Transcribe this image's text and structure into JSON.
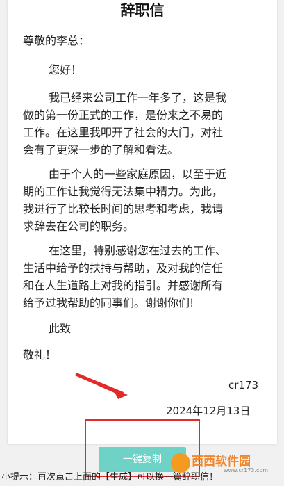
{
  "letter": {
    "title": "辞职信",
    "salutation": "尊敬的李总：",
    "greeting": "您好！",
    "paragraphs": [
      [
        "我已经来公司工作一年多了，这是我",
        "做的第一份正式的工作，是份来之不易的",
        "工作。在这里我叩开了社会的大门，对社",
        "会有了更深一步的了解和看法。"
      ],
      [
        "由于个人的一些家庭原因，以至于近",
        "期的工作让我觉得无法集中精力。为此，",
        "我进行了比较长时间的思考和考虑，我请",
        "求辞去在公司的职务。"
      ],
      [
        "在这里，特别感谢您在过去的工作、",
        "生活中给予的扶持与帮助，及对我的信任",
        "和在人生道路上对我的指引。并感谢所有",
        "给予过我帮助的同事们。谢谢你们!"
      ]
    ],
    "closing1": "此致",
    "closing2": "敬礼！",
    "signature": "cr173",
    "date": "2024年12月13日"
  },
  "action": {
    "button_label": "一键复制"
  },
  "tip": "小提示：再次点击上面的【生成】可以换一篇辞职信！",
  "watermark": {
    "text": "西西软件园",
    "url": "www.cr173.com"
  },
  "colors": {
    "button": "#6fd2c7",
    "highlight": "#e32a2a",
    "watermark": "#f1862b"
  }
}
